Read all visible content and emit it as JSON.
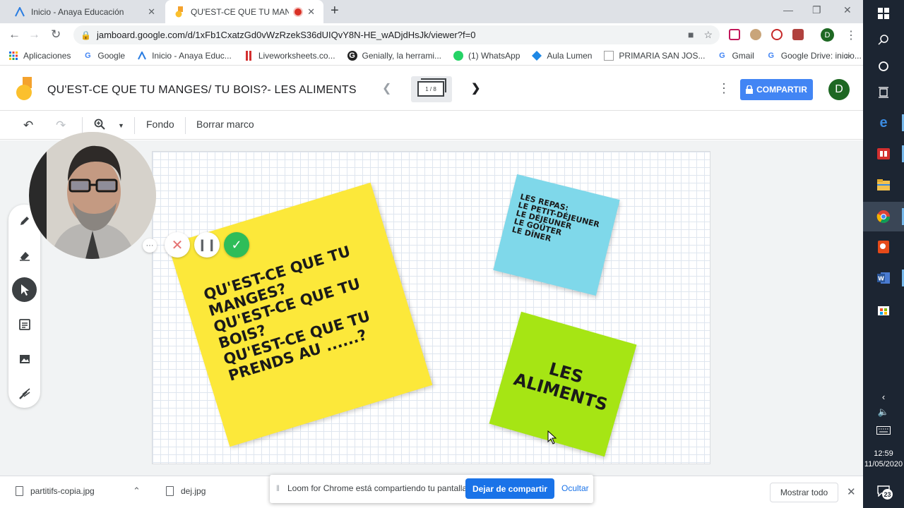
{
  "browser": {
    "tabs": [
      {
        "title": "Inicio - Anaya Educación",
        "close": "✕"
      },
      {
        "title": "QU'EST-CE QUE TU MANGES",
        "close": "✕"
      }
    ],
    "new_tab": "+",
    "url": "jamboard.google.com/d/1xFb1CxatzGd0vWzRzekS36dUIQvY8N-HE_wADjdHsJk/viewer?f=0",
    "profile_initial": "D",
    "bookmarks": [
      {
        "label": "Aplicaciones"
      },
      {
        "label": "Google"
      },
      {
        "label": "Inicio - Anaya Educ..."
      },
      {
        "label": "Liveworksheets.co..."
      },
      {
        "label": "Genially, la herrami..."
      },
      {
        "label": "(1) WhatsApp"
      },
      {
        "label": "Aula Lumen"
      },
      {
        "label": "PRIMARIA SAN JOS..."
      },
      {
        "label": "Gmail"
      },
      {
        "label": "Google Drive: inicio..."
      }
    ],
    "bookmarks_more": "»"
  },
  "jamboard": {
    "title": "QU'EST-CE QUE TU MANGES/ TU BOIS?- LES ALIMENTS",
    "frame_indicator": "1 / 8",
    "share_label": "COMPARTIR",
    "avatar_initial": "D",
    "toolbar": {
      "background_label": "Fondo",
      "clear_frame_label": "Borrar marco"
    },
    "notes": {
      "yellow": [
        "QU'EST-CE QUE TU",
        "MANGES?",
        "QU'EST-CE QUE TU",
        "BOIS?",
        "QU'EST-CE QUE TU",
        "PRENDS AU ......?"
      ],
      "blue": [
        "LES REPAS:",
        "LE PETIT-DÉJEUNER",
        "LE DÉJEUNER",
        "LE GOÛTER",
        "LE DÎNER"
      ],
      "green": [
        "LES",
        "ALIMENTS"
      ]
    }
  },
  "downloads": {
    "items": [
      {
        "name": "partitifs-copia.jpg"
      },
      {
        "name": "dej.jpg"
      }
    ],
    "show_all": "Mostrar todo"
  },
  "loom": {
    "message": "Loom for Chrome está compartiendo tu pantalla.",
    "stop_sharing": "Dejar de compartir",
    "hide": "Ocultar"
  },
  "taskbar": {
    "time": "12:59",
    "date": "11/05/2020",
    "notification_count": "23"
  },
  "colors": {
    "share_button": "#4285f4",
    "note_yellow": "#fce83a",
    "note_blue": "#7fd8ea",
    "note_green": "#a6e514",
    "loom_done": "#2ebd59",
    "taskbar": "#1c2532"
  }
}
